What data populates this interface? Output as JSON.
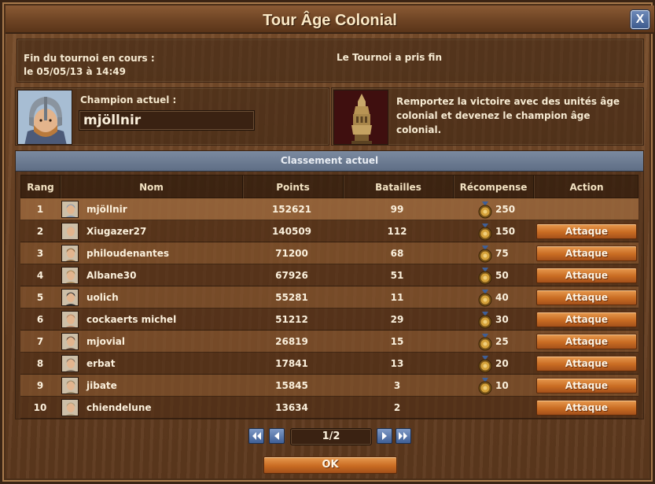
{
  "window": {
    "title": "Tour Âge Colonial",
    "close_label": "X"
  },
  "tournament": {
    "end_label": "Fin du tournoi en cours :",
    "end_date": "le 05/05/13 à 14:49",
    "status": "Le Tournoi a pris fin"
  },
  "champion": {
    "label": "Champion actuel :",
    "name": "mjöllnir",
    "avatar_icon": "viking-helmet-avatar-icon"
  },
  "goal": {
    "icon": "tower-trophy-icon",
    "text": "Remportez la victoire avec des unités âge colonial et devenez le champion âge colonial."
  },
  "ranking": {
    "header": "Classement actuel",
    "columns": {
      "rank": "Rang",
      "name": "Nom",
      "points": "Points",
      "battles": "Batailles",
      "reward": "Récompense",
      "action": "Action"
    },
    "attack_label": "Attaque",
    "rows": [
      {
        "rank": "1",
        "name": "mjöllnir",
        "points": "152621",
        "battles": "99",
        "reward": "250",
        "attack": false
      },
      {
        "rank": "2",
        "name": "Xiugazer27",
        "points": "140509",
        "battles": "112",
        "reward": "150",
        "attack": true
      },
      {
        "rank": "3",
        "name": "philoudenantes",
        "points": "71200",
        "battles": "68",
        "reward": "75",
        "attack": true
      },
      {
        "rank": "4",
        "name": "Albane30",
        "points": "67926",
        "battles": "51",
        "reward": "50",
        "attack": true
      },
      {
        "rank": "5",
        "name": "uolich",
        "points": "55281",
        "battles": "11",
        "reward": "40",
        "attack": true
      },
      {
        "rank": "6",
        "name": "cockaerts michel",
        "points": "51212",
        "battles": "29",
        "reward": "30",
        "attack": true
      },
      {
        "rank": "7",
        "name": "mjovial",
        "points": "26819",
        "battles": "15",
        "reward": "25",
        "attack": true
      },
      {
        "rank": "8",
        "name": "erbat",
        "points": "17841",
        "battles": "13",
        "reward": "20",
        "attack": true
      },
      {
        "rank": "9",
        "name": "jibate",
        "points": "15845",
        "battles": "3",
        "reward": "10",
        "attack": true
      },
      {
        "rank": "10",
        "name": "chiendelune",
        "points": "13634",
        "battles": "2",
        "reward": "",
        "attack": true
      }
    ]
  },
  "pagination": {
    "current": "1/2"
  },
  "ok_label": "OK",
  "colors": {
    "attack_button": "#c96c23",
    "pager_button": "#3f5f96",
    "header_band": "#6b7a92"
  }
}
